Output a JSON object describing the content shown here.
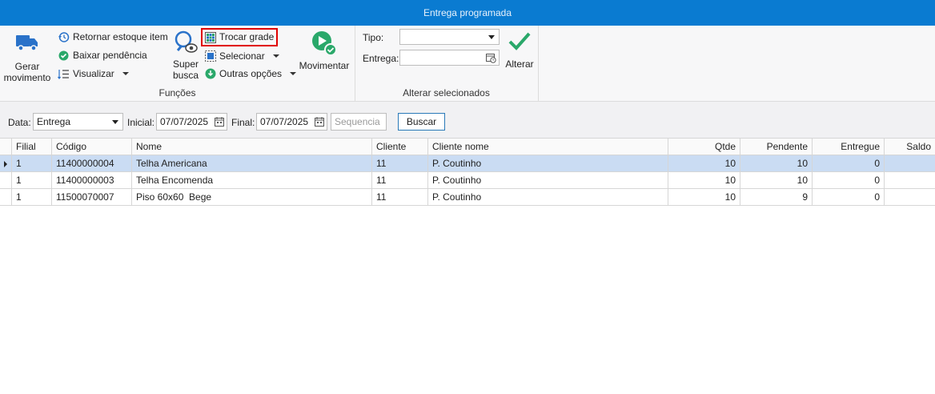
{
  "window": {
    "title": "Entrega programada"
  },
  "ribbon": {
    "gerar_movimento": {
      "line1": "Gerar",
      "line2": "movimento"
    },
    "retornar_estoque": "Retornar estoque item",
    "baixar_pendencia": "Baixar pendência",
    "visualizar": "Visualizar",
    "super_busca": {
      "line1": "Super",
      "line2": "busca"
    },
    "trocar_grade": "Trocar grade",
    "selecionar": "Selecionar",
    "outras_opcoes": "Outras opções",
    "movimentar": "Movimentar",
    "funcoes_label": "Funções",
    "tipo_label": "Tipo:",
    "tipo_value": "",
    "entrega_label": "Entrega:",
    "entrega_value": "",
    "alterar": "Alterar",
    "alterar_selecionados_label": "Alterar selecionados"
  },
  "filters": {
    "data_label": "Data:",
    "data_value": "Entrega",
    "inicial_label": "Inicial:",
    "inicial_value": "07/07/2025",
    "final_label": "Final:",
    "final_value": "07/07/2025",
    "sequencia_placeholder": "Sequencia",
    "buscar": "Buscar"
  },
  "grid": {
    "columns": [
      "Filial",
      "Código",
      "Nome",
      "Cliente",
      "Cliente nome",
      "Qtde",
      "Pendente",
      "Entregue",
      "Saldo"
    ],
    "rows": [
      {
        "filial": "1",
        "codigo": "11400000004",
        "nome": "Telha Americana",
        "cliente": "11",
        "cliente_nome": "P. Coutinho",
        "qtde": "10",
        "pendente": "10",
        "entregue": "0",
        "saldo": ""
      },
      {
        "filial": "1",
        "codigo": "11400000003",
        "nome": "Telha Encomenda",
        "cliente": "11",
        "cliente_nome": "P. Coutinho",
        "qtde": "10",
        "pendente": "10",
        "entregue": "0",
        "saldo": ""
      },
      {
        "filial": "1",
        "codigo": "11500070007",
        "nome": "Piso 60x60  Bege",
        "cliente": "11",
        "cliente_nome": "P. Coutinho",
        "qtde": "10",
        "pendente": "9",
        "entregue": "0",
        "saldo": ""
      }
    ]
  },
  "colors": {
    "titlebar": "#0a7bd1",
    "selected_row": "#cadcf3",
    "highlight_border": "#e00000",
    "accent_green": "#2aa86a"
  }
}
